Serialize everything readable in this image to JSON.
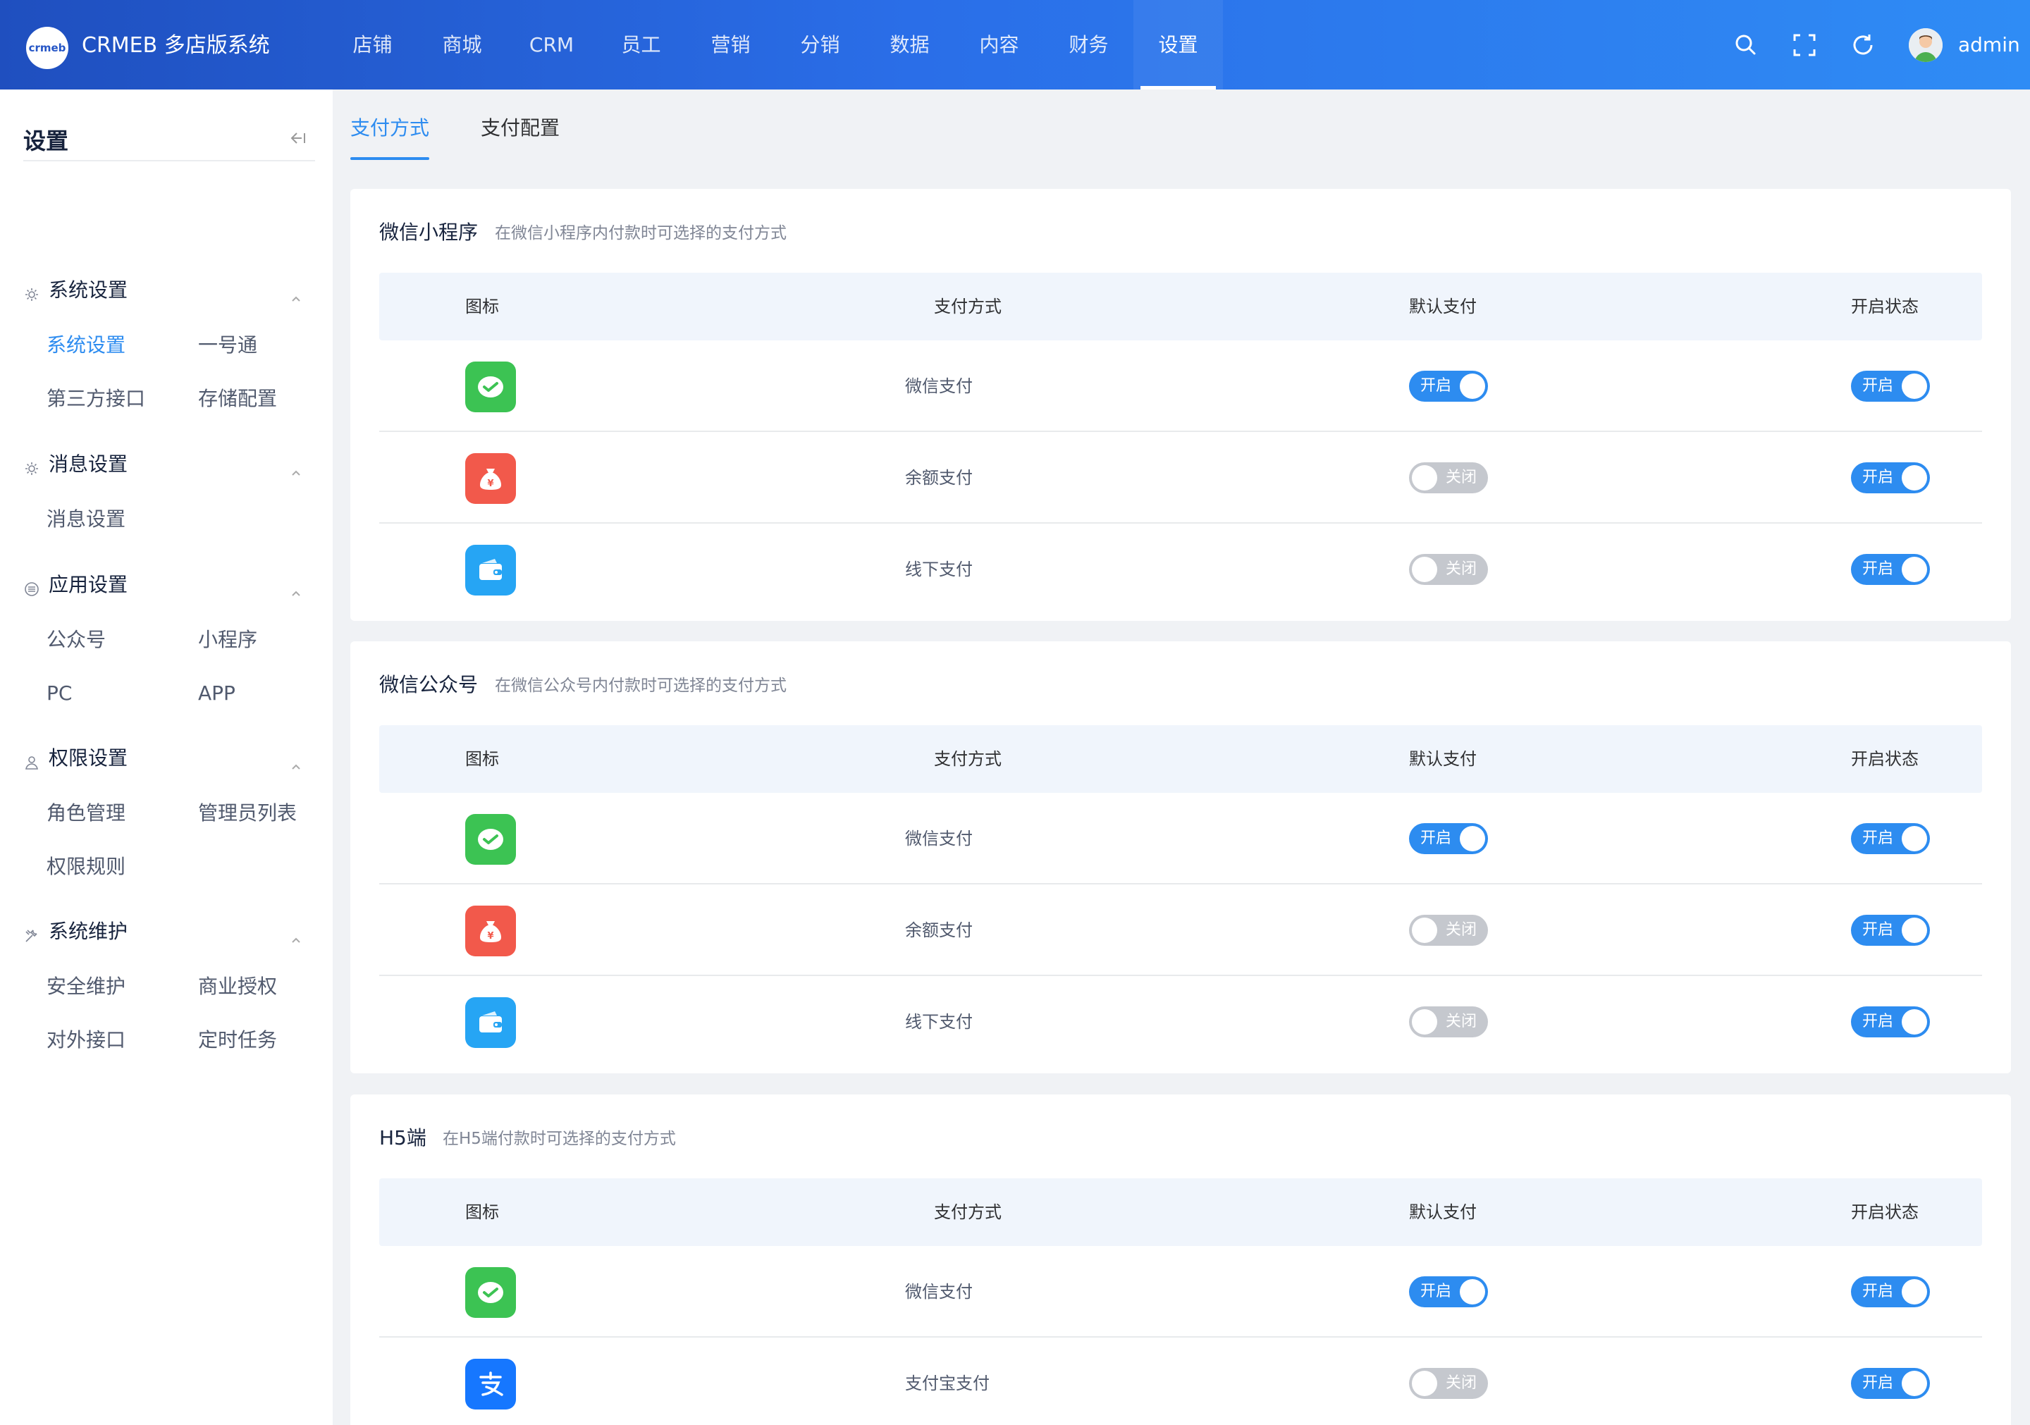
{
  "header": {
    "logo_text": "crmeb",
    "brand": "CRMEB 多店版系统",
    "nav": [
      "店铺",
      "商城",
      "CRM",
      "员工",
      "营销",
      "分销",
      "数据",
      "内容",
      "财务",
      "设置"
    ],
    "active_nav": "设置",
    "user": "admin"
  },
  "sidebar": {
    "title": "设置",
    "groups": [
      {
        "label": "系统设置",
        "icon": "gear-icon",
        "items": [
          "系统设置",
          "一号通",
          "第三方接口",
          "存储配置"
        ],
        "active": "系统设置"
      },
      {
        "label": "消息设置",
        "icon": "gear-icon",
        "items": [
          "消息设置"
        ]
      },
      {
        "label": "应用设置",
        "icon": "app-icon",
        "items": [
          "公众号",
          "小程序",
          "PC",
          "APP"
        ]
      },
      {
        "label": "权限设置",
        "icon": "user-icon",
        "items": [
          "角色管理",
          "管理员列表",
          "权限规则"
        ]
      },
      {
        "label": "系统维护",
        "icon": "tools-icon",
        "items": [
          "安全维护",
          "商业授权",
          "对外接口",
          "定时任务"
        ]
      }
    ]
  },
  "tabs": [
    "支付方式",
    "支付配置"
  ],
  "active_tab": "支付方式",
  "table_headers": [
    "图标",
    "支付方式",
    "默认支付",
    "开启状态"
  ],
  "switch_labels": {
    "on": "开启",
    "off": "关闭"
  },
  "sections": [
    {
      "title": "微信小程序",
      "desc": "在微信小程序内付款时可选择的支付方式",
      "rows": [
        {
          "icon": "wechat-pay-icon",
          "name": "微信支付",
          "default": true,
          "enabled": true
        },
        {
          "icon": "balance-pay-icon",
          "name": "余额支付",
          "default": false,
          "enabled": true
        },
        {
          "icon": "offline-pay-icon",
          "name": "线下支付",
          "default": false,
          "enabled": true
        }
      ]
    },
    {
      "title": "微信公众号",
      "desc": "在微信公众号内付款时可选择的支付方式",
      "rows": [
        {
          "icon": "wechat-pay-icon",
          "name": "微信支付",
          "default": true,
          "enabled": true
        },
        {
          "icon": "balance-pay-icon",
          "name": "余额支付",
          "default": false,
          "enabled": true
        },
        {
          "icon": "offline-pay-icon",
          "name": "线下支付",
          "default": false,
          "enabled": true
        }
      ]
    },
    {
      "title": "H5端",
      "desc": "在H5端付款时可选择的支付方式",
      "rows": [
        {
          "icon": "wechat-pay-icon",
          "name": "微信支付",
          "default": true,
          "enabled": true
        },
        {
          "icon": "alipay-icon",
          "name": "支付宝支付",
          "default": false,
          "enabled": true
        }
      ]
    }
  ],
  "colors": {
    "primary": "#2d8cf0",
    "switch_off": "#c5c8ce",
    "wechat": "#3cc353",
    "balance": "#f2594b",
    "offline": "#26a5f4",
    "alipay": "#1677ff"
  }
}
